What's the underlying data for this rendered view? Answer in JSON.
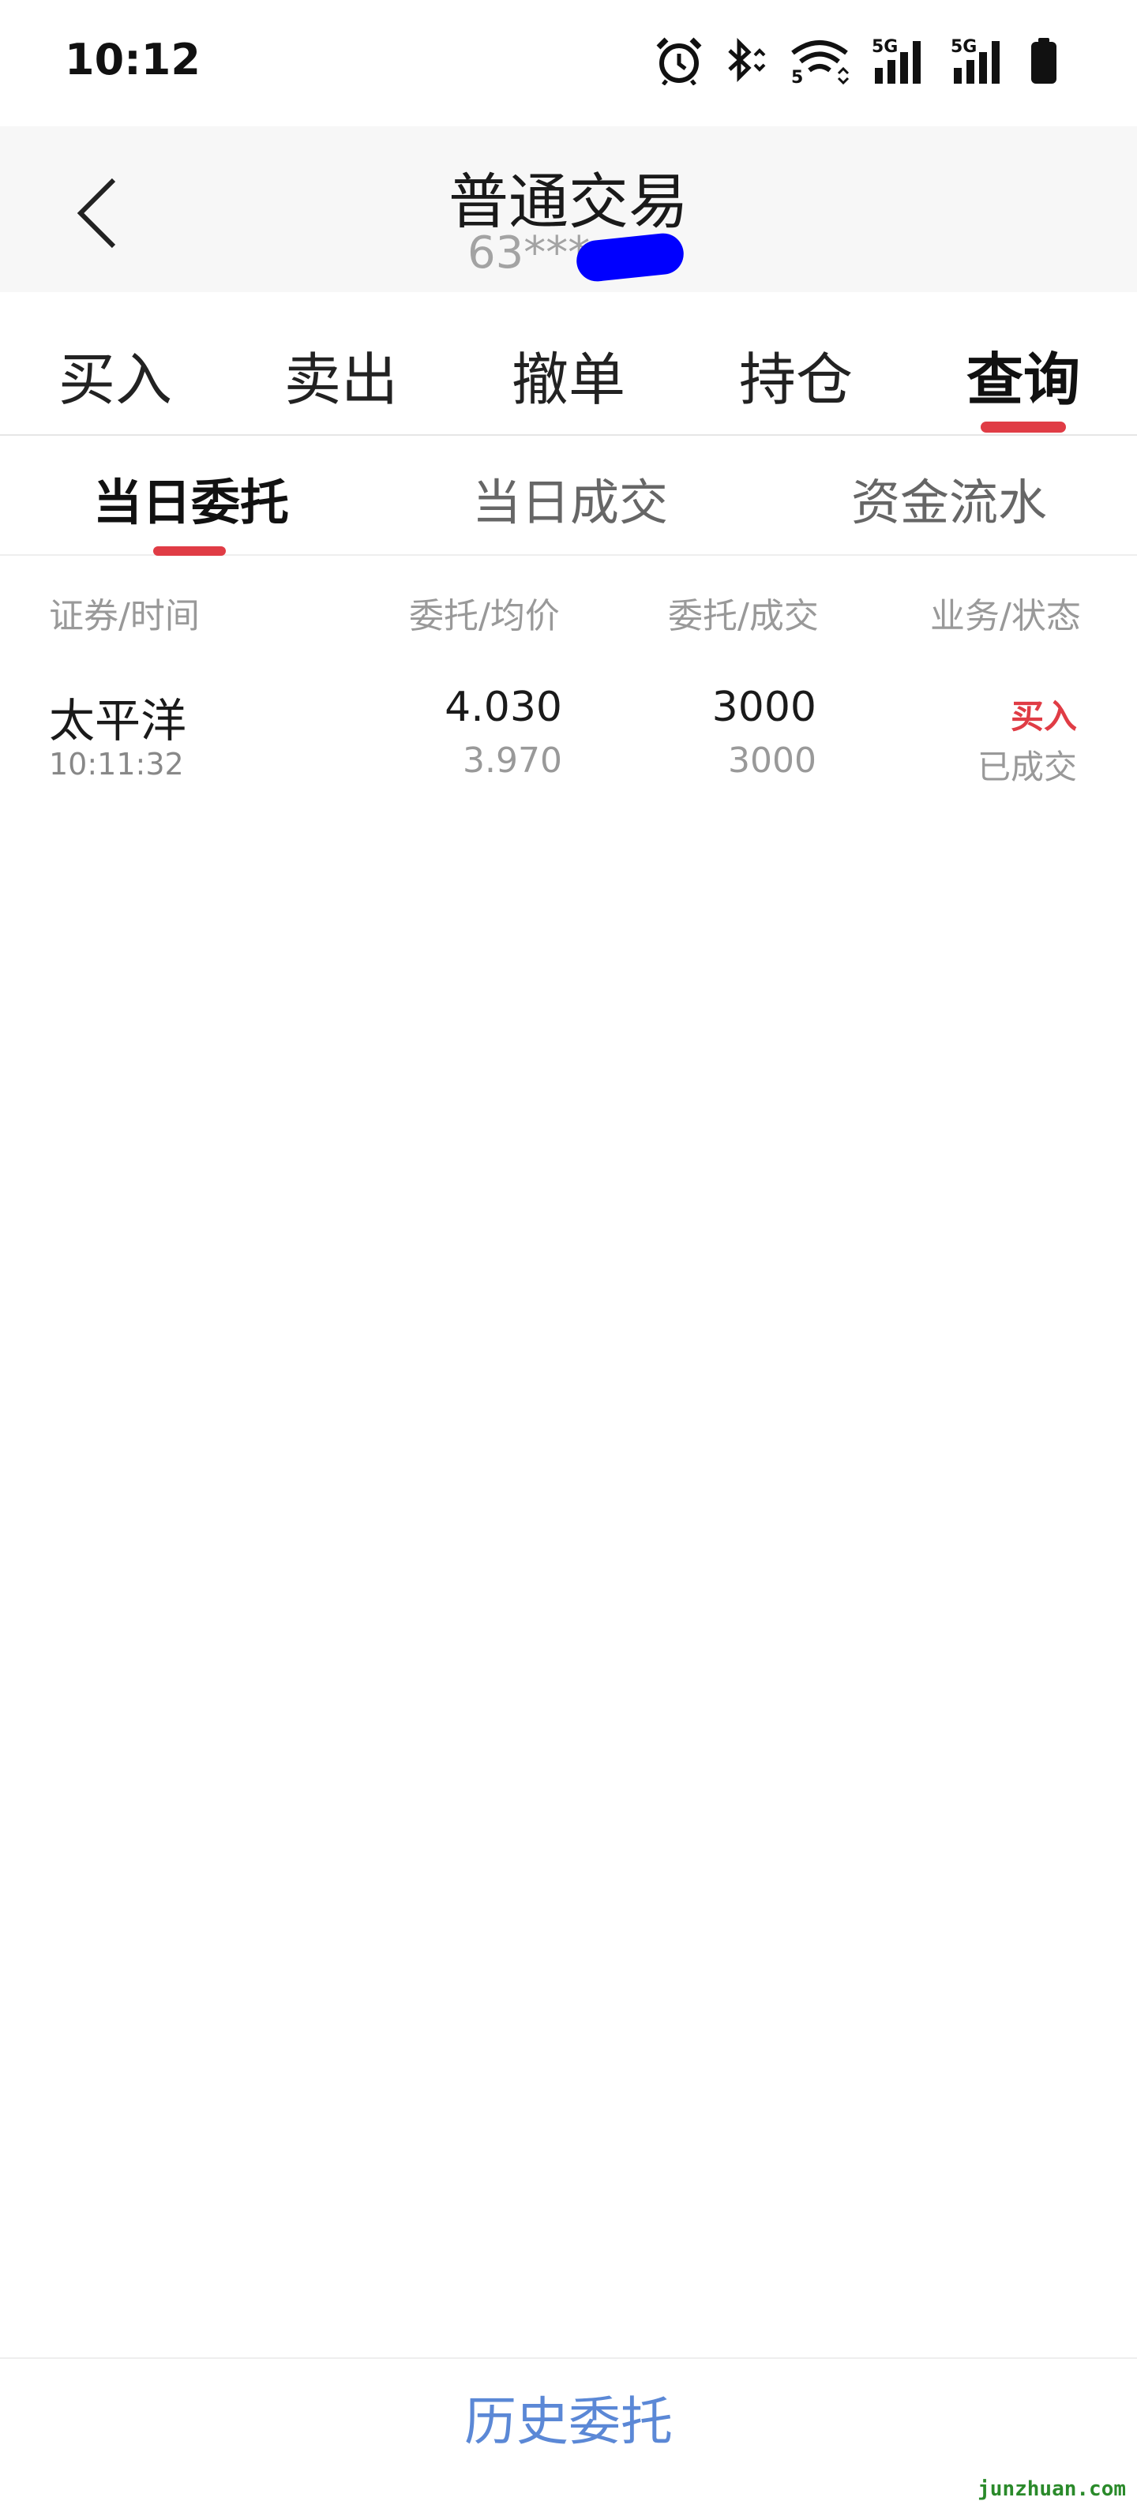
{
  "status_bar": {
    "time": "10:12",
    "icons": [
      "alarm-icon",
      "bluetooth-icon",
      "wifi-icon",
      "signal-5g-icon",
      "signal-5g-icon",
      "battery-icon"
    ],
    "network_label": "5G",
    "wifi_label": "5"
  },
  "header": {
    "title": "普通交易",
    "account": "63***"
  },
  "main_tabs": [
    {
      "label": "买入"
    },
    {
      "label": "卖出"
    },
    {
      "label": "撤单"
    },
    {
      "label": "持仓"
    },
    {
      "label": "查询",
      "active": true
    }
  ],
  "sub_tabs": [
    {
      "label": "当日委托",
      "active": true
    },
    {
      "label": "当日成交"
    },
    {
      "label": "资金流水"
    }
  ],
  "table": {
    "headers": [
      "证券/时间",
      "委托/均价",
      "委托/成交",
      "业务/状态"
    ],
    "rows": [
      {
        "name": "太平洋",
        "time": "10:11:32",
        "order_price": "4.030",
        "avg_price": "3.970",
        "order_qty": "3000",
        "filled_qty": "3000",
        "business": "买入",
        "status": "已成交"
      }
    ]
  },
  "bottom": {
    "history_label": "历史委托"
  },
  "watermark": "junzhuan.com",
  "colors": {
    "accent": "#e03c45",
    "link": "#5b88d6",
    "redaction": "#0000ff",
    "watermark": "#2a8a2a"
  }
}
